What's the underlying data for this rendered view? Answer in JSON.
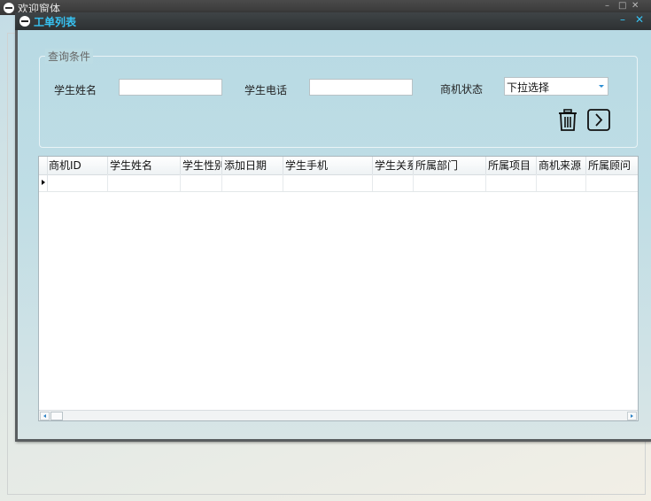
{
  "outer_window": {
    "title": "欢迎窗体",
    "controls": {
      "minimize": "–",
      "maximize": "□",
      "close": "✕"
    }
  },
  "child_window": {
    "title": "工单列表",
    "controls": {
      "minimize": "–",
      "close": "✕"
    }
  },
  "query": {
    "legend": "查询条件",
    "student_name_label": "学生姓名",
    "student_name_value": "",
    "student_phone_label": "学生电话",
    "student_phone_value": "",
    "opportunity_status_label": "商机状态",
    "opportunity_status_selected": "下拉选择",
    "delete_icon": "trash-icon",
    "next_icon": "chevron-right-icon"
  },
  "grid": {
    "columns": [
      "商机ID",
      "学生姓名",
      "学生性别",
      "添加日期",
      "学生手机",
      "学生关系",
      "所属部门",
      "所属项目",
      "商机来源",
      "所属顾问"
    ],
    "rows": [
      [
        "",
        "",
        "",
        "",
        "",
        "",
        "",
        "",
        "",
        ""
      ]
    ]
  }
}
